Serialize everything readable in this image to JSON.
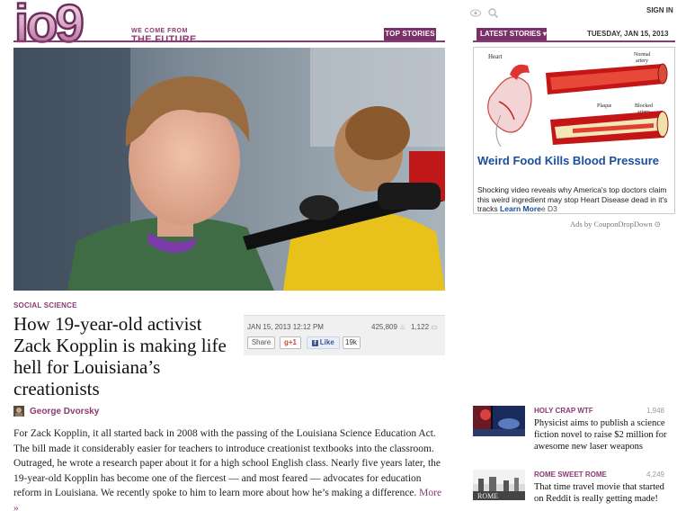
{
  "header": {
    "logo_text": "io9",
    "tagline_top": "WE COME FROM",
    "tagline_bottom": "THE FUTURE",
    "top_stories_label": "TOP STORIES",
    "sign_in_label": "SIGN IN"
  },
  "article": {
    "section": "SOCIAL SCIENCE",
    "headline": "How 19-year-old activist Zack Kopplin is making life hell for Louisiana’s creationists",
    "author": "George Dvorsky",
    "body": "For Zack Kopplin, it all started back in 2008 with the passing of the Louisiana Science Education Act. The bill made it considerably easier for teachers to introduce creationist textbooks into the classroom. Outraged, he wrote a research paper about it for a high school English class. Nearly five years later, the 19-year-old Kopplin has become one of the fiercest — and most feared — advocates for education reform in Louisiana. We recently spoke to him to learn more about how he’s making a difference.",
    "more_label": "More »",
    "meta": {
      "date": "JAN 15, 2013 12:12 PM",
      "views": "425,809",
      "comments": "1,122",
      "share_label": "Share",
      "gplus_label": "+1",
      "like_label": "Like",
      "like_count": "19k"
    }
  },
  "sidebar": {
    "latest_stories_label": "LATEST STORIES ▾",
    "date": "TUESDAY, JAN 15, 2013",
    "ad": {
      "diagram_labels": {
        "heart": "Heart",
        "normal_artery": "Normal artery",
        "plaque": "Plaque",
        "blocked_artery": "Blocked artery"
      },
      "title": "Weird Food Kills Blood Pressure",
      "text": "Shocking video reveals why America's top doctors claim this weird ingredient may stop Heart Disease dead in it's tracks",
      "more_label": "Learn More",
      "overlap_text": "e D3",
      "credit": "Ads by CouponDropDown ⊙"
    },
    "stories": [
      {
        "category": "HOLY CRAP WTF",
        "count": "1,948",
        "title": "Physicist aims to publish a science fiction novel to raise $2 million for awesome new laser weapons"
      },
      {
        "category": "ROME SWEET ROME",
        "count": "4,249",
        "title": "That time travel movie that started on Reddit is really getting made!",
        "thumb_text": "ROME"
      }
    ]
  },
  "colors": {
    "brand_purple": "#8b3a73",
    "ad_link_blue": "#1a4fa0"
  },
  "icons": [
    "eye-icon",
    "search-icon",
    "author-icon",
    "flame-icon",
    "comment-icon"
  ]
}
